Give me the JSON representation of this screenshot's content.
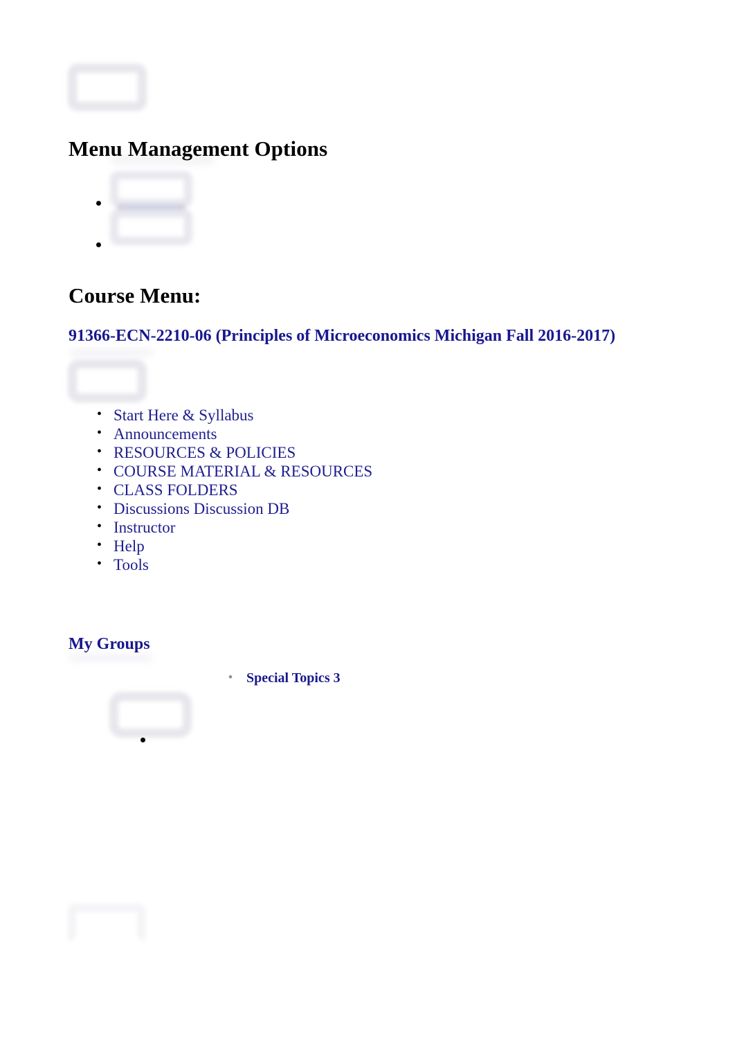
{
  "document": {
    "title": "Menu Management Options",
    "headings": {
      "menu_management": "Menu Management Options",
      "course_menu": "Course Menu:",
      "my_groups": "My Groups"
    },
    "course_link": "91366-ECN-2210-06 (Principles of Microeconomics Michigan Fall 2016-2017)",
    "course_menu_items": [
      {
        "label": "Start Here & Syllabus"
      },
      {
        "label": "Announcements"
      },
      {
        "label": "RESOURCES & POLICIES"
      },
      {
        "label": "COURSE MATERIAL & RESOURCES"
      },
      {
        "label": "CLASS FOLDERS"
      },
      {
        "label": "Discussions Discussion DB"
      },
      {
        "label": "Instructor"
      },
      {
        "label": "Help"
      },
      {
        "label": "Tools"
      }
    ],
    "groups": [
      {
        "label": "Special Topics 3"
      }
    ],
    "placeholders": [
      {
        "name": "top-screenshot-placeholder"
      },
      {
        "name": "menu-options-screenshot-placeholder"
      },
      {
        "name": "course-menu-screenshot-placeholder"
      },
      {
        "name": "groups-screenshot-placeholder"
      },
      {
        "name": "bottom-screenshot-placeholder"
      }
    ],
    "colors": {
      "link_navy": "#1d1d8e",
      "heading_black": "#000000",
      "placeholder_gray": "#e6e6ec",
      "bullet_gray": "#8f8f8f",
      "page_background": "#ffffff"
    }
  }
}
